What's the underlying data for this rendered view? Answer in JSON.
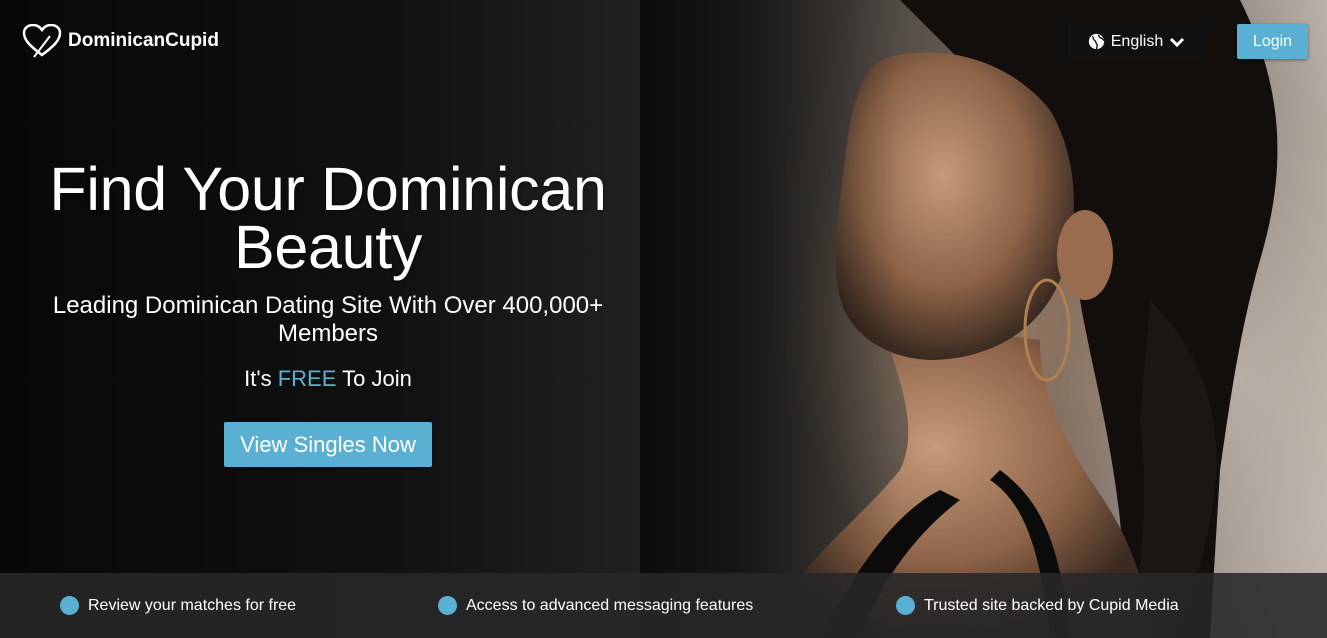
{
  "header": {
    "logo_text": "DominicanCupid",
    "language_label": "English",
    "login_label": "Login"
  },
  "hero": {
    "headline_line1": "Find Your Dominican",
    "headline_line2": "Beauty",
    "subheadline": "Leading Dominican Dating Site With Over 400,000+ Members",
    "free_prefix": "It's ",
    "free_highlight": "FREE",
    "free_suffix": " To Join",
    "cta_label": "View Singles Now"
  },
  "features": [
    {
      "label": "Review your matches for free"
    },
    {
      "label": "Access to advanced messaging features"
    },
    {
      "label": "Trusted site backed by Cupid Media"
    }
  ],
  "colors": {
    "accent": "#5ab0d2",
    "features_bar": "#282828",
    "background": "#0c0c0c"
  },
  "icons": {
    "logo": "heart-logo-icon",
    "language": "globe-icon",
    "dropdown": "chevron-down-icon",
    "feature_bullet": "dot-icon"
  }
}
